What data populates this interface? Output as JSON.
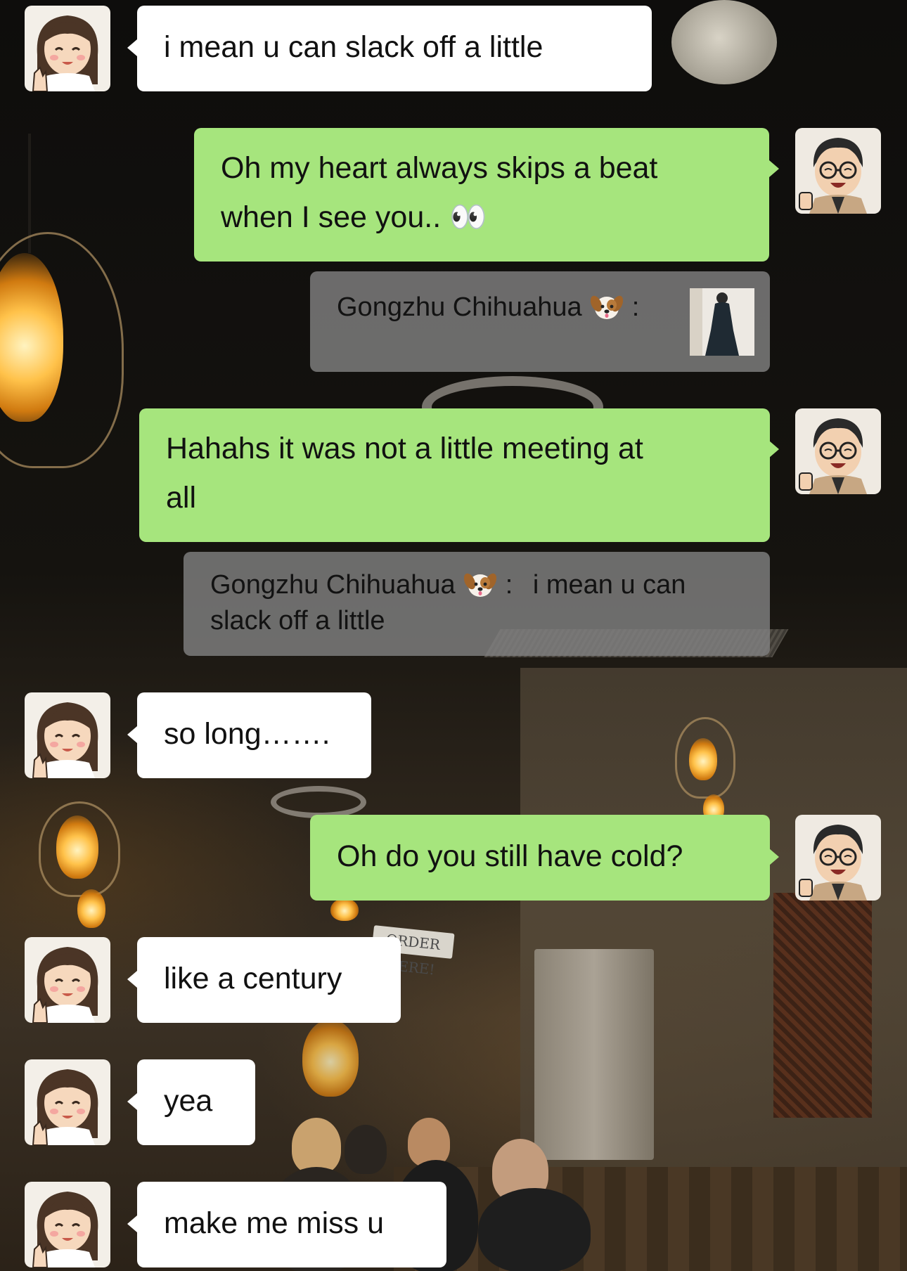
{
  "contact": {
    "name": "Gongzhu Chihuahua",
    "name_emoji": "🐶",
    "colon": ":"
  },
  "messages": [
    {
      "id": "m1",
      "side": "left",
      "text": "i mean u can slack off a little"
    },
    {
      "id": "m2",
      "side": "right",
      "line1": "Oh my heart always skips a beat",
      "line2": "when I see you.. 👀"
    },
    {
      "id": "q1",
      "side": "quote",
      "sender": "Gongzhu Chihuahua",
      "emoji": "🐶",
      "colon": ":",
      "attachment": "photo"
    },
    {
      "id": "m3",
      "side": "right",
      "line1": "Hahahs it was not a little meeting at",
      "line2": "all"
    },
    {
      "id": "q2",
      "side": "quote",
      "sender": "Gongzhu Chihuahua",
      "emoji": "🐶",
      "colon": ":",
      "text_line1": "i mean u can",
      "text_line2": "slack off a little"
    },
    {
      "id": "m4",
      "side": "left",
      "text": "so long……."
    },
    {
      "id": "m5",
      "side": "right",
      "text": "Oh do you still have cold?"
    },
    {
      "id": "m6",
      "side": "left",
      "text": "like a century"
    },
    {
      "id": "m7",
      "side": "left",
      "text": "yea"
    },
    {
      "id": "m8",
      "side": "left",
      "text": "make me miss u"
    }
  ],
  "background_sign": "ORDER HERE!",
  "colors": {
    "sent_bubble": "#a6e57d",
    "received_bubble": "#ffffff",
    "quote_bubble": "#808080",
    "text": "#111111"
  },
  "icons": {
    "avatar_left": "girl-avatar-icon",
    "avatar_right": "boy-avatar-icon",
    "emoji": "dog-face-icon"
  }
}
